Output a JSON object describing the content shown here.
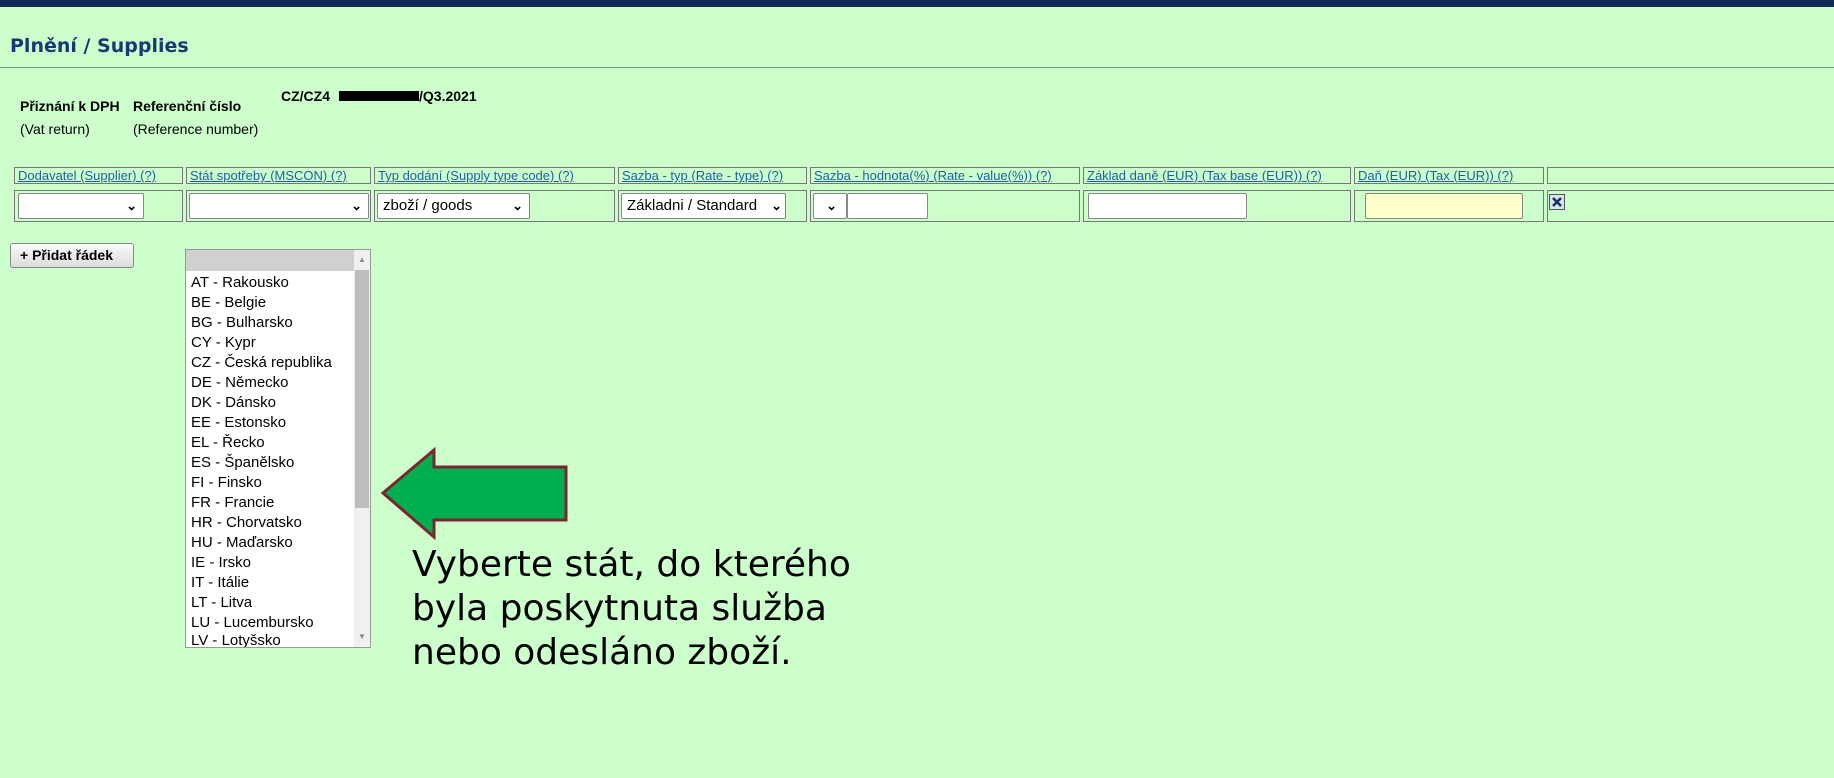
{
  "page": {
    "title": "Plnění / Supplies"
  },
  "return_info": {
    "label": "Přiznání k DPH",
    "label_en": "(Vat return)",
    "ref_label": "Referenční číslo",
    "ref_label_en": "(Reference number)",
    "ref_prefix": "CZ/CZ4",
    "ref_suffix": "/Q3.2021"
  },
  "table": {
    "headers": [
      "Dodavatel (Supplier) (?)",
      "Stát spotřeby (MSCON) (?)",
      "Typ dodání (Supply type code) (?)",
      "Sazba - typ (Rate - type) (?)",
      "Sazba - hodnota(%) (Rate - value(%)) (?)",
      "Základ daně (EUR) (Tax base (EUR)) (?)",
      "Daň (EUR) (Tax (EUR)) (?)"
    ],
    "row": {
      "supplier": "",
      "mscon": "",
      "supply_type": "zboží / goods",
      "rate_type": "Základni / Standard",
      "rate_value": "",
      "tax_base": "",
      "tax": ""
    },
    "delete_icon": "close-x-icon"
  },
  "add_row_button": "+ Přidat řádek",
  "country_dropdown": {
    "options": [
      "AT - Rakousko",
      "BE - Belgie",
      "BG - Bulharsko",
      "CY - Kypr",
      "CZ - Česká republika",
      "DE - Německo",
      "DK - Dánsko",
      "EE - Estonsko",
      "EL - Řecko",
      "ES - Španělsko",
      "FI - Finsko",
      "FR - Francie",
      "HR - Chorvatsko",
      "HU - Maďarsko",
      "IE - Irsko",
      "IT - Itálie",
      "LT - Litva",
      "LU - Lucembursko",
      "LV - Lotyšsko"
    ]
  },
  "annotation": {
    "lines": [
      "Vyberte stát, do kterého",
      "byla poskytnuta služba",
      "nebo odesláno zboží."
    ],
    "arrow_color": "#00b050",
    "arrow_border": "#7b2432"
  },
  "colors": {
    "background": "#ccffcc",
    "topbar": "#0f2d57",
    "title": "#173a76",
    "link": "#1f5fa0",
    "tax_field": "#ffffcc"
  }
}
